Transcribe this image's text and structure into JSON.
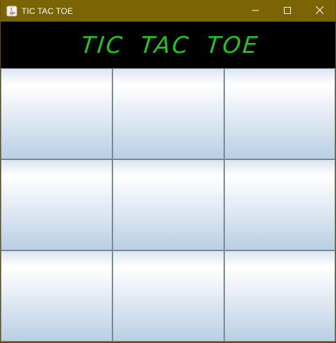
{
  "window": {
    "title": "TIC TAC TOE"
  },
  "titlebar_buttons": [
    "minimize",
    "maximize",
    "close"
  ],
  "game": {
    "heading": "TIC TAC TOE",
    "heading_color": "#1ec81e",
    "board": [
      [
        "",
        "",
        ""
      ],
      [
        "",
        "",
        ""
      ],
      [
        "",
        "",
        ""
      ]
    ]
  }
}
